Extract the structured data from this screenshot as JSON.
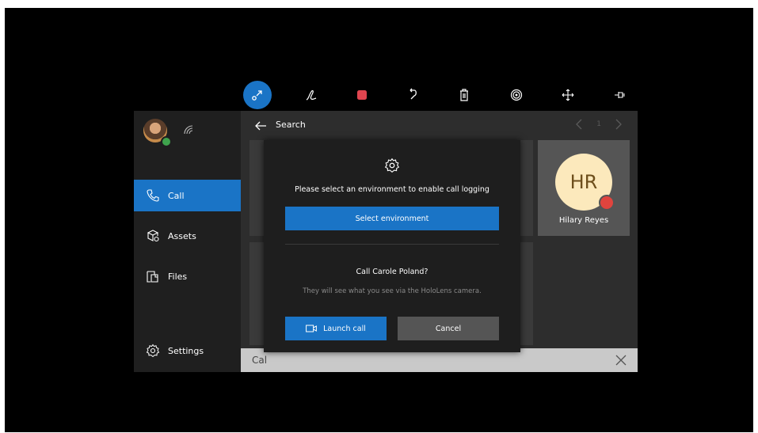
{
  "toolbar": {
    "tools": [
      "pointer-icon",
      "pen-icon",
      "color-icon",
      "undo-icon",
      "delete-icon",
      "record-icon",
      "move-icon",
      "pin-icon"
    ],
    "accent_color": "#1a74c6",
    "ink_color": "#e0454f"
  },
  "sidebar": {
    "items": [
      {
        "label": "Call",
        "icon": "phone-icon",
        "active": true
      },
      {
        "label": "Assets",
        "icon": "assets-icon",
        "active": false
      },
      {
        "label": "Files",
        "icon": "files-icon",
        "active": false
      },
      {
        "label": "Settings",
        "icon": "gear-icon",
        "active": false
      }
    ]
  },
  "header": {
    "search_label": "Search",
    "page_number": "1"
  },
  "contact": {
    "initials": "HR",
    "name": "Hilary Reyes",
    "status_color": "#e0443e"
  },
  "dialog": {
    "message": "Please select an environment to enable call logging",
    "select_button": "Select environment",
    "call_title": "Call Carole Poland?",
    "call_subtitle": "They will see what you see via the HoloLens camera.",
    "launch_button": "Launch call",
    "cancel_button": "Cancel"
  },
  "bottom_bar": {
    "text": "Cal"
  }
}
